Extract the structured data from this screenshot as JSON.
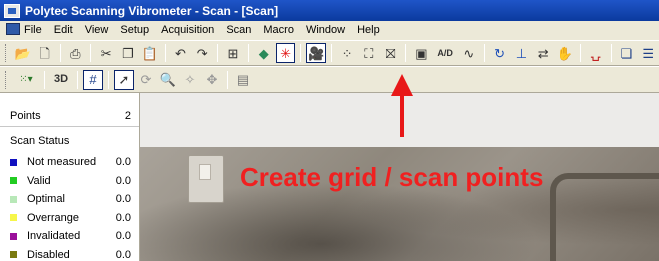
{
  "window": {
    "title": "Polytec Scanning Vibrometer - Scan - [Scan]"
  },
  "menubar": {
    "items": [
      "File",
      "Edit",
      "View",
      "Setup",
      "Acquisition",
      "Scan",
      "Macro",
      "Window",
      "Help"
    ]
  },
  "toolbar1": {
    "icons": [
      "open-icon",
      "new-icon",
      "print-icon",
      "cut-icon",
      "copy-icon",
      "paste-icon",
      "undo-icon",
      "redo-icon",
      "tree-icon",
      "laser-diamond-icon",
      "laser-star-icon",
      "camera-icon",
      "snap-points-icon",
      "define-grid-icon",
      "create-grid-scan-points-icon",
      "measure-icon",
      "ad-settings-label",
      "generator-icon",
      "refresh-icon",
      "one-point-icon",
      "arrows-icon",
      "hand-icon",
      "signal-icon",
      "windows-icon",
      "split-icon"
    ],
    "ad_label": "A/D"
  },
  "toolbar2": {
    "label_3d": "3D",
    "icons": [
      "palette-dropdown-icon",
      "grid-icon",
      "pointer-icon",
      "rotate-icon",
      "zoom-icon",
      "light-icon",
      "move-icon",
      "list-icon"
    ]
  },
  "points": {
    "label": "Points",
    "count": "2"
  },
  "scan_status": {
    "header": "Scan Status",
    "rows": [
      {
        "label": "Not measured",
        "value": "0.0",
        "color": "#1010c0"
      },
      {
        "label": "Valid",
        "value": "0.0",
        "color": "#22cc22"
      },
      {
        "label": "Optimal",
        "value": "0.0",
        "color": "#b8e8b8"
      },
      {
        "label": "Overrange",
        "value": "0.0",
        "color": "#f6f64a"
      },
      {
        "label": "Invalidated",
        "value": "0.0",
        "color": "#9a109a"
      },
      {
        "label": "Disabled",
        "value": "0.0",
        "color": "#7a7a10"
      }
    ]
  },
  "annotation": {
    "text": "Create grid / scan points",
    "color": "#f02020"
  }
}
